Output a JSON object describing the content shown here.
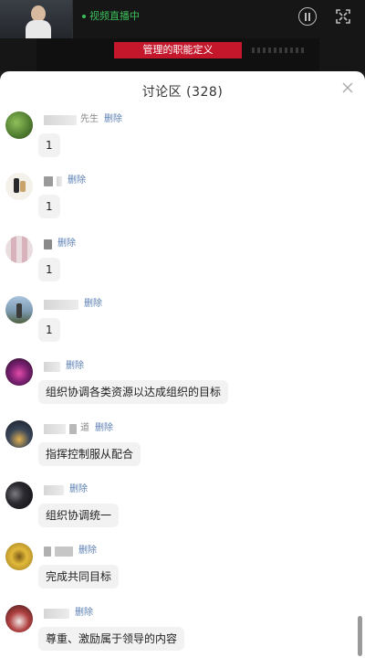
{
  "video": {
    "status": "视频直播中",
    "slide_title": "管理的职能定义"
  },
  "panel": {
    "title": "讨论区 (328)"
  },
  "delete_label": "删除",
  "comments": [
    {
      "name_visible": "先生",
      "text": "1",
      "avatar_color": "#5b8a3c"
    },
    {
      "name_visible": "",
      "text": "1",
      "avatar_color": "#e9e4da"
    },
    {
      "name_visible": "",
      "text": "1",
      "avatar_color": "#e6c9cf"
    },
    {
      "name_visible": "",
      "text": "1",
      "avatar_color": "#8fb0cc"
    },
    {
      "name_visible": "",
      "text": "组织协调各类资源以达成组织的目标",
      "avatar_color": "#6b2a5a"
    },
    {
      "name_visible": "道",
      "text": "指挥控制服从配合",
      "avatar_color": "#2b3440"
    },
    {
      "name_visible": "",
      "text": "组织协调统一",
      "avatar_color": "#1e1e22"
    },
    {
      "name_visible": "",
      "text": "完成共同目标",
      "avatar_color": "#c7a23a"
    },
    {
      "name_visible": "",
      "text": "尊重、激励属于领导的内容",
      "avatar_color": "#7a2a2a"
    }
  ]
}
